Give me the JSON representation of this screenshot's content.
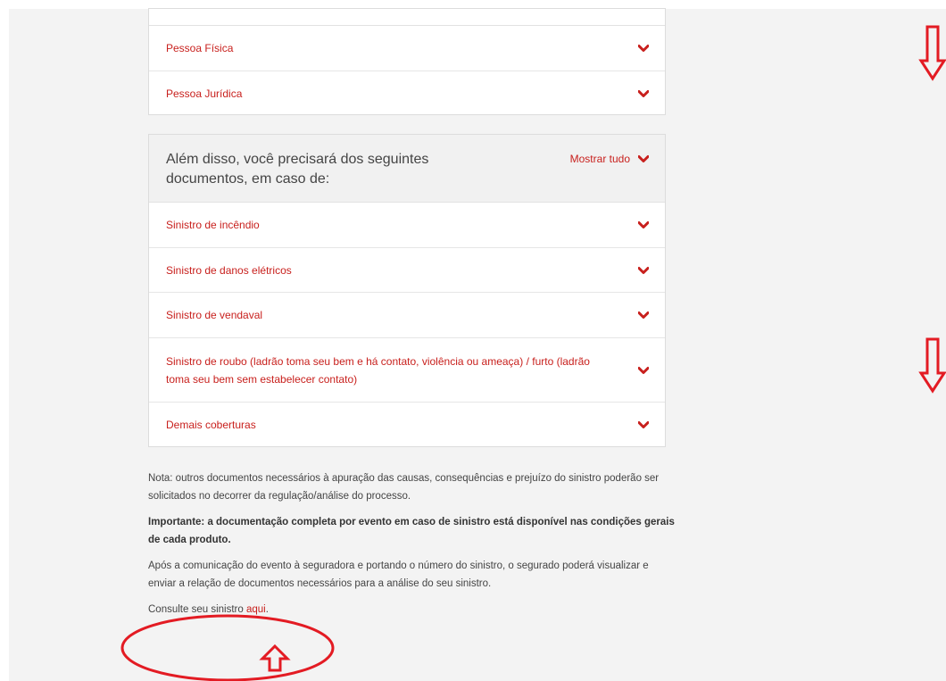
{
  "top_card": {
    "items": [
      {
        "label": "Pessoa Física"
      },
      {
        "label": "Pessoa Jurídica"
      }
    ]
  },
  "documents_card": {
    "title": "Além disso, você precisará dos seguintes documentos, em caso de:",
    "show_all_label": "Mostrar tudo",
    "items": [
      {
        "label": "Sinistro de incêndio"
      },
      {
        "label": "Sinistro de danos elétricos"
      },
      {
        "label": "Sinistro de vendaval"
      },
      {
        "label": "Sinistro de roubo (ladrão toma seu bem e há contato, violência ou ameaça) / furto (ladrão toma seu bem sem estabelecer contato)"
      },
      {
        "label": "Demais coberturas"
      }
    ]
  },
  "notes": {
    "nota": "Nota: outros documentos necessários à apuração das causas, consequências e prejuízo do sinistro poderão ser solicitados no decorrer da regulação/análise do processo.",
    "importante": "Importante: a documentação completa por evento em caso de sinistro está disponível nas condições gerais de cada produto.",
    "apos": "Após a comunicação do evento à seguradora e portando o número do sinistro, o segurado poderá visualizar e enviar a relação de documentos necessários para a análise do seu sinistro.",
    "consulte_prefix": "Consulte seu sinistro ",
    "consulte_link": "aqui",
    "consulte_suffix": "."
  },
  "colors": {
    "accent": "#c8201d",
    "annotation": "#e31b23",
    "page_bg": "#f3f3f3"
  }
}
